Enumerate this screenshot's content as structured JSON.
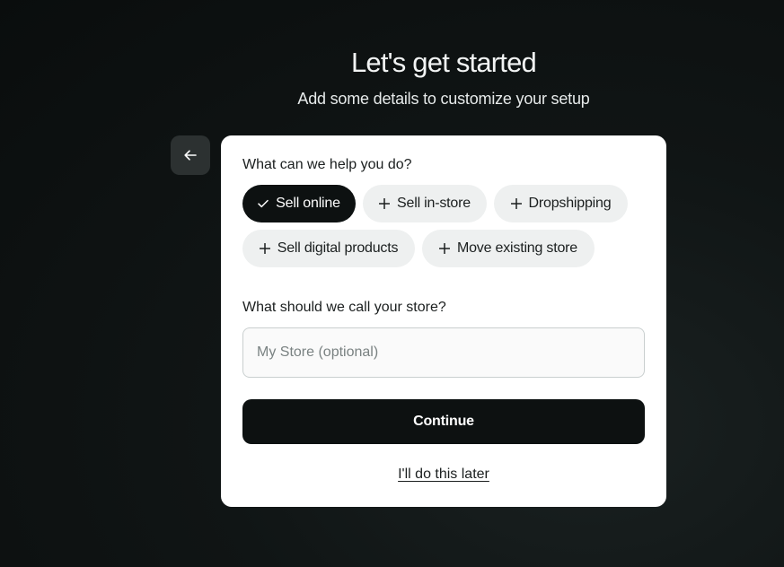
{
  "header": {
    "title": "Let's get started",
    "subtitle": "Add some details to customize your setup"
  },
  "back_button": {
    "icon": "arrow-left-icon"
  },
  "form": {
    "help_question": "What can we help you do?",
    "options": [
      {
        "label": "Sell online",
        "selected": true,
        "icon": "check-icon"
      },
      {
        "label": "Sell in-store",
        "selected": false,
        "icon": "plus-icon"
      },
      {
        "label": "Dropshipping",
        "selected": false,
        "icon": "plus-icon"
      },
      {
        "label": "Sell digital products",
        "selected": false,
        "icon": "plus-icon"
      },
      {
        "label": "Move existing store",
        "selected": false,
        "icon": "plus-icon"
      }
    ],
    "store_name_question": "What should we call your store?",
    "store_name_value": "",
    "store_name_placeholder": "My Store (optional)",
    "continue_label": "Continue",
    "later_label": "I'll do this later"
  },
  "colors": {
    "background": "#0f1414",
    "card": "#ffffff",
    "primary": "#0d1111",
    "chip": "#eef0f0"
  }
}
